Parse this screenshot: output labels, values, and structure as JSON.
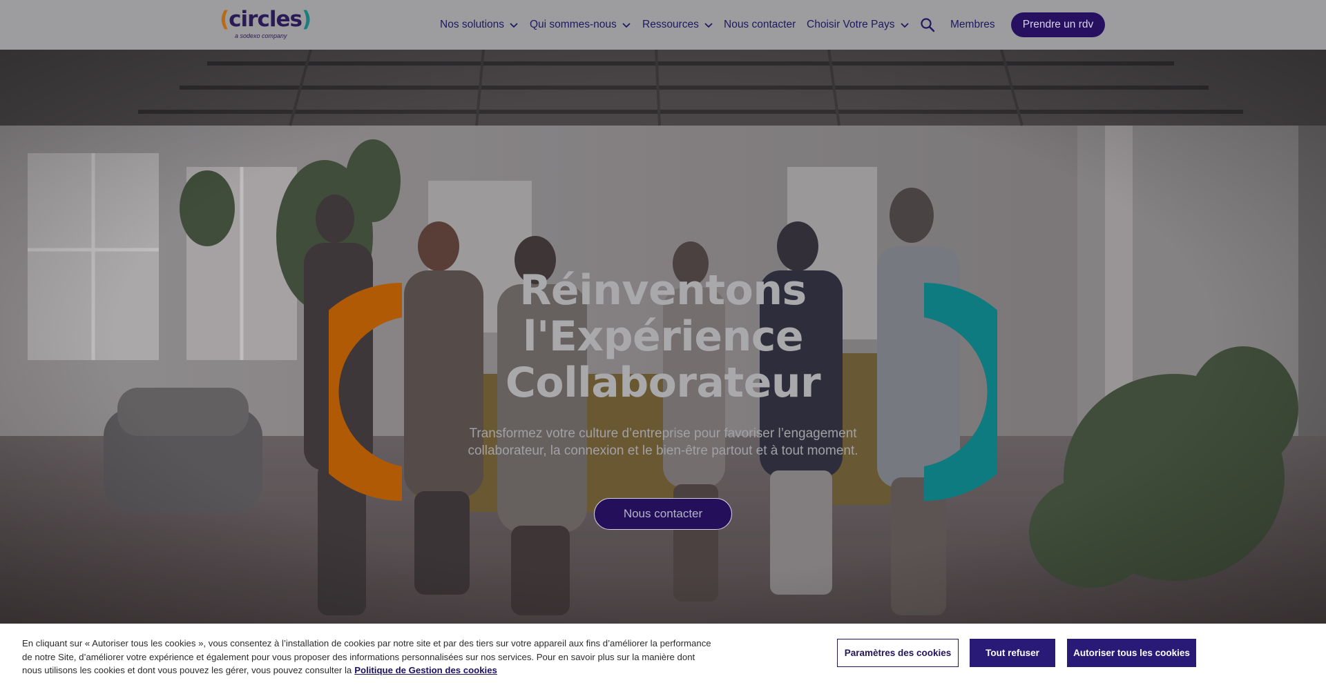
{
  "colors": {
    "brand_dark": "#26105f",
    "arc_orange": "#b15a06",
    "arc_teal": "#0e7b80",
    "header_bg": "#9d9d9f",
    "cookie_button": "#2a1a78"
  },
  "logo": {
    "open_paren": "(",
    "word": "circles",
    "close_paren": ")",
    "tagline": "a sodexo company"
  },
  "nav": {
    "items": [
      {
        "label": "Nos solutions",
        "has_dropdown": true
      },
      {
        "label": "Qui sommes-nous",
        "has_dropdown": true
      },
      {
        "label": "Ressources",
        "has_dropdown": true
      },
      {
        "label": "Nous contacter",
        "has_dropdown": false
      },
      {
        "label": "Choisir Votre Pays",
        "has_dropdown": true
      }
    ],
    "search_icon": "search-icon",
    "members_label": "Membres",
    "cta_label": "Prendre un rdv"
  },
  "hero": {
    "background": "office-people-networking-photo",
    "title_lines": [
      "Réinventons",
      "l'Expérience",
      "Collaborateur"
    ],
    "subtitle_lines": [
      "Transformez votre culture d’entreprise pour favoriser l’engagement",
      "collaborateur, la connexion et le bien-être partout et à tout moment."
    ],
    "cta_label": "Nous contacter"
  },
  "cookie_banner": {
    "text_lines": [
      "En cliquant sur « Autoriser tous les cookies », vous consentez à l’installation de cookies par notre site et par des tiers sur votre appareil aux fins d’améliorer la performance",
      "de notre Site, d’améliorer votre expérience et également pour vous proposer des informations personnalisées sur nos services. Pour en savoir plus sur la manière dont",
      "nous utilisons les cookies et dont vous pouvez les gérer, vous pouvez consulter la"
    ],
    "policy_link": "Politique de Gestion des cookies",
    "settings_label": "Paramètres des cookies",
    "refuse_label": "Tout refuser",
    "accept_label": "Autoriser tous les cookies"
  }
}
